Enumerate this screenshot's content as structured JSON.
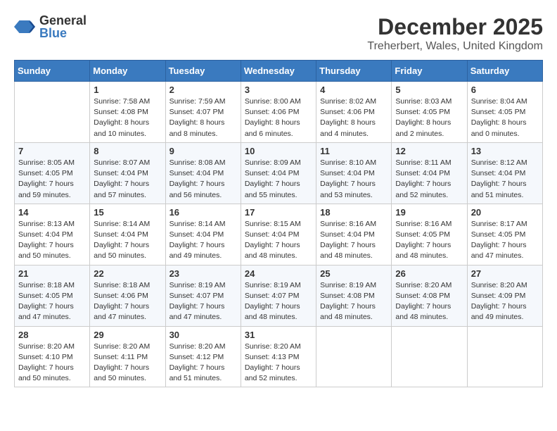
{
  "header": {
    "logo_general": "General",
    "logo_blue": "Blue",
    "month_title": "December 2025",
    "location": "Treherbert, Wales, United Kingdom"
  },
  "days_of_week": [
    "Sunday",
    "Monday",
    "Tuesday",
    "Wednesday",
    "Thursday",
    "Friday",
    "Saturday"
  ],
  "weeks": [
    [
      {
        "day": "",
        "info": ""
      },
      {
        "day": "1",
        "info": "Sunrise: 7:58 AM\nSunset: 4:08 PM\nDaylight: 8 hours\nand 10 minutes."
      },
      {
        "day": "2",
        "info": "Sunrise: 7:59 AM\nSunset: 4:07 PM\nDaylight: 8 hours\nand 8 minutes."
      },
      {
        "day": "3",
        "info": "Sunrise: 8:00 AM\nSunset: 4:06 PM\nDaylight: 8 hours\nand 6 minutes."
      },
      {
        "day": "4",
        "info": "Sunrise: 8:02 AM\nSunset: 4:06 PM\nDaylight: 8 hours\nand 4 minutes."
      },
      {
        "day": "5",
        "info": "Sunrise: 8:03 AM\nSunset: 4:05 PM\nDaylight: 8 hours\nand 2 minutes."
      },
      {
        "day": "6",
        "info": "Sunrise: 8:04 AM\nSunset: 4:05 PM\nDaylight: 8 hours\nand 0 minutes."
      }
    ],
    [
      {
        "day": "7",
        "info": "Sunrise: 8:05 AM\nSunset: 4:05 PM\nDaylight: 7 hours\nand 59 minutes."
      },
      {
        "day": "8",
        "info": "Sunrise: 8:07 AM\nSunset: 4:04 PM\nDaylight: 7 hours\nand 57 minutes."
      },
      {
        "day": "9",
        "info": "Sunrise: 8:08 AM\nSunset: 4:04 PM\nDaylight: 7 hours\nand 56 minutes."
      },
      {
        "day": "10",
        "info": "Sunrise: 8:09 AM\nSunset: 4:04 PM\nDaylight: 7 hours\nand 55 minutes."
      },
      {
        "day": "11",
        "info": "Sunrise: 8:10 AM\nSunset: 4:04 PM\nDaylight: 7 hours\nand 53 minutes."
      },
      {
        "day": "12",
        "info": "Sunrise: 8:11 AM\nSunset: 4:04 PM\nDaylight: 7 hours\nand 52 minutes."
      },
      {
        "day": "13",
        "info": "Sunrise: 8:12 AM\nSunset: 4:04 PM\nDaylight: 7 hours\nand 51 minutes."
      }
    ],
    [
      {
        "day": "14",
        "info": "Sunrise: 8:13 AM\nSunset: 4:04 PM\nDaylight: 7 hours\nand 50 minutes."
      },
      {
        "day": "15",
        "info": "Sunrise: 8:14 AM\nSunset: 4:04 PM\nDaylight: 7 hours\nand 50 minutes."
      },
      {
        "day": "16",
        "info": "Sunrise: 8:14 AM\nSunset: 4:04 PM\nDaylight: 7 hours\nand 49 minutes."
      },
      {
        "day": "17",
        "info": "Sunrise: 8:15 AM\nSunset: 4:04 PM\nDaylight: 7 hours\nand 48 minutes."
      },
      {
        "day": "18",
        "info": "Sunrise: 8:16 AM\nSunset: 4:04 PM\nDaylight: 7 hours\nand 48 minutes."
      },
      {
        "day": "19",
        "info": "Sunrise: 8:16 AM\nSunset: 4:05 PM\nDaylight: 7 hours\nand 48 minutes."
      },
      {
        "day": "20",
        "info": "Sunrise: 8:17 AM\nSunset: 4:05 PM\nDaylight: 7 hours\nand 47 minutes."
      }
    ],
    [
      {
        "day": "21",
        "info": "Sunrise: 8:18 AM\nSunset: 4:05 PM\nDaylight: 7 hours\nand 47 minutes."
      },
      {
        "day": "22",
        "info": "Sunrise: 8:18 AM\nSunset: 4:06 PM\nDaylight: 7 hours\nand 47 minutes."
      },
      {
        "day": "23",
        "info": "Sunrise: 8:19 AM\nSunset: 4:07 PM\nDaylight: 7 hours\nand 47 minutes."
      },
      {
        "day": "24",
        "info": "Sunrise: 8:19 AM\nSunset: 4:07 PM\nDaylight: 7 hours\nand 48 minutes."
      },
      {
        "day": "25",
        "info": "Sunrise: 8:19 AM\nSunset: 4:08 PM\nDaylight: 7 hours\nand 48 minutes."
      },
      {
        "day": "26",
        "info": "Sunrise: 8:20 AM\nSunset: 4:08 PM\nDaylight: 7 hours\nand 48 minutes."
      },
      {
        "day": "27",
        "info": "Sunrise: 8:20 AM\nSunset: 4:09 PM\nDaylight: 7 hours\nand 49 minutes."
      }
    ],
    [
      {
        "day": "28",
        "info": "Sunrise: 8:20 AM\nSunset: 4:10 PM\nDaylight: 7 hours\nand 50 minutes."
      },
      {
        "day": "29",
        "info": "Sunrise: 8:20 AM\nSunset: 4:11 PM\nDaylight: 7 hours\nand 50 minutes."
      },
      {
        "day": "30",
        "info": "Sunrise: 8:20 AM\nSunset: 4:12 PM\nDaylight: 7 hours\nand 51 minutes."
      },
      {
        "day": "31",
        "info": "Sunrise: 8:20 AM\nSunset: 4:13 PM\nDaylight: 7 hours\nand 52 minutes."
      },
      {
        "day": "",
        "info": ""
      },
      {
        "day": "",
        "info": ""
      },
      {
        "day": "",
        "info": ""
      }
    ]
  ]
}
